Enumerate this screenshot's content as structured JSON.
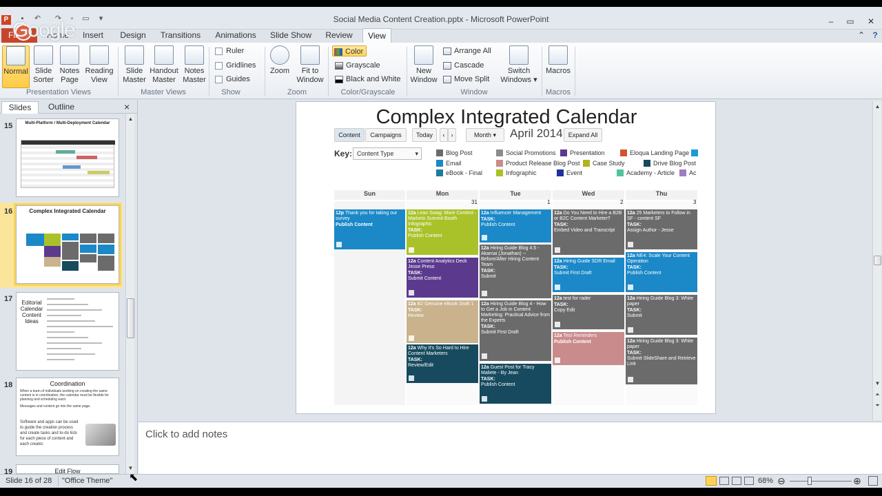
{
  "window": {
    "title": "Social Media Content Creation.pptx - Microsoft PowerPoint"
  },
  "watermark": "Google",
  "tabs": [
    "File",
    "Home",
    "Insert",
    "Design",
    "Transitions",
    "Animations",
    "Slide Show",
    "Review",
    "View"
  ],
  "active_tab": "View",
  "ribbon": {
    "presentation_views": {
      "label": "Presentation Views",
      "buttons": [
        "Normal",
        "Slide Sorter",
        "Notes Page",
        "Reading View"
      ]
    },
    "master_views": {
      "label": "Master Views",
      "buttons": [
        "Slide Master",
        "Handout Master",
        "Notes Master"
      ]
    },
    "show": {
      "label": "Show",
      "items": [
        "Ruler",
        "Gridlines",
        "Guides"
      ]
    },
    "zoom": {
      "label": "Zoom",
      "buttons": [
        "Zoom",
        "Fit to Window"
      ]
    },
    "color_grayscale": {
      "label": "Color/Grayscale",
      "items": [
        "Color",
        "Grayscale",
        "Black and White"
      ]
    },
    "window": {
      "label": "Window",
      "new_window": "New Window",
      "items": [
        "Arrange All",
        "Cascade",
        "Move Split"
      ],
      "switch": "Switch Windows"
    },
    "macros": {
      "label": "Macros",
      "button": "Macros"
    }
  },
  "panel": {
    "tabs": [
      "Slides",
      "Outline"
    ],
    "close": "×"
  },
  "thumbnails": [
    {
      "num": "15",
      "title": "Multi-Platform / Multi-Deployment Calendar"
    },
    {
      "num": "16",
      "title": "Complex Integrated Calendar"
    },
    {
      "num": "17",
      "title": "Editorial Calendar Content Ideas"
    },
    {
      "num": "18",
      "title": "Coordination",
      "body1": "When a team of individuals working on creating the same content is in coordination, the calendar must be flexible for planning and scheduling each.",
      "body2": "Messages and content go into the same page.",
      "body3": "Software and apps can be used to guide the creation process and create tasks and to-do lists for each piece of content and each creator."
    },
    {
      "num": "19",
      "title": "Edit Flow"
    }
  ],
  "slide": {
    "title": "Complex Integrated Calendar",
    "toolbar": {
      "content": "Content",
      "campaigns": "Campaigns",
      "today": "Today",
      "prev": "‹",
      "next": "›",
      "view": "Month",
      "month": "April 2014",
      "expand": "Expand All"
    },
    "key_label": "Key:",
    "key_select": "Content Type",
    "key_items": [
      {
        "label": "Blog Post",
        "color": "#6b6b6b"
      },
      {
        "label": "Social Promotions",
        "color": "#8c8c8c"
      },
      {
        "label": "Presentation",
        "color": "#5b3a8e"
      },
      {
        "label": "Eloqua Landing Page",
        "color": "#d2542c"
      },
      {
        "label": "Email",
        "color": "#1b88c8"
      },
      {
        "label": "Product Release Blog Post",
        "color": "#c98b8b"
      },
      {
        "label": "Case Study",
        "color": "#b2b21e"
      },
      {
        "label": "Drive Blog Post",
        "color": "#174a5e"
      },
      {
        "label": "eBook - Final",
        "color": "#1f7a9e"
      },
      {
        "label": "Infographic",
        "color": "#a9c22a"
      },
      {
        "label": "Event",
        "color": "#2030a0"
      },
      {
        "label": "Academy - Article",
        "color": "#4fc3a1"
      },
      {
        "label": "Ac",
        "color": "#a07cc0"
      }
    ],
    "days": [
      "Sun",
      "Mon",
      "Tue",
      "Wed",
      "Thu"
    ],
    "dates": [
      "",
      "31",
      "1",
      "2",
      "3"
    ],
    "events": [
      {
        "time": "12p",
        "title": "Thank you for taking our survey",
        "task": "",
        "desc": "Publish Content",
        "color": "#1b88c8"
      },
      {
        "time": "12a",
        "title": "Lean Swag: More Content - Marketo Summit Booth Infographic",
        "task": "TASK:",
        "desc": "Publish Content",
        "color": "#a9c22a"
      },
      {
        "time": "12a",
        "title": "Content Analytics Deck Jesse Preso",
        "task": "TASK:",
        "desc": "Submit Content",
        "color": "#5b3a8e"
      },
      {
        "time": "12a",
        "title": "B2 Genuine eBook Draft 1",
        "task": "TASK:",
        "desc": "Review",
        "color": "#c9b28c"
      },
      {
        "time": "12a",
        "title": "Why It's So Hard to Hire Content Marketers",
        "task": "TASK:",
        "desc": "Review/Edit",
        "color": "#174a5e"
      },
      {
        "time": "12a",
        "title": "Influencer Management",
        "task": "TASK:",
        "desc": "Publish Content",
        "color": "#1b88c8"
      },
      {
        "time": "12a",
        "title": "Hiring Guide Blog 4.5 - Akamai (Jonathan) -- Before/After Hiring Content Team",
        "task": "TASK:",
        "desc": "Submit",
        "color": "#6b6b6b"
      },
      {
        "time": "12a",
        "title": "Hiring Guide Blog 4 - How to Get a Job in Content Marketing: Practical Advice from the Experts",
        "task": "TASK:",
        "desc": "Submit First Draft",
        "color": "#6b6b6b"
      },
      {
        "time": "12a",
        "title": "Guest Post for Tracy Maliete - By Jean",
        "task": "TASK:",
        "desc": "Publish Content",
        "color": "#174a5e"
      },
      {
        "time": "12a",
        "title": "Do You Need to Hire a B2B or B2C Content Marketer?",
        "task": "TASK:",
        "desc": "Embed Video and Transcript",
        "color": "#6b6b6b"
      },
      {
        "time": "12a",
        "title": "Hiring Guide SDR Email",
        "task": "TASK:",
        "desc": "Submit First Draft",
        "color": "#1b88c8"
      },
      {
        "time": "12a",
        "title": "test for rader",
        "task": "TASK:",
        "desc": "Copy Edit",
        "color": "#6b6b6b"
      },
      {
        "time": "12a",
        "title": "Test Reminders",
        "task": "",
        "desc": "Publish Content",
        "color": "#c98b8b"
      },
      {
        "time": "12a",
        "title": "25 Marketers to Follow in SF - content SF",
        "task": "TASK:",
        "desc": "Assign Author - Jesse",
        "color": "#6b6b6b"
      },
      {
        "time": "12a",
        "title": "NE4: Scale Your Content Operation",
        "task": "TASK:",
        "desc": "Publish Content",
        "color": "#1b88c8"
      },
      {
        "time": "12a",
        "title": "Hiring Guide Blog 3: White paper",
        "task": "TASK:",
        "desc": "Submit",
        "color": "#6b6b6b"
      },
      {
        "time": "12a",
        "title": "Hiring Guide Blog 3: White paper",
        "task": "TASK:",
        "desc": "Submit SlideShare and Retrieve Link",
        "color": "#6b6b6b"
      }
    ]
  },
  "notes": {
    "placeholder": "Click to add notes"
  },
  "status": {
    "slide": "Slide 16 of 28",
    "theme": "\"Office Theme\"",
    "zoom": "68%"
  }
}
